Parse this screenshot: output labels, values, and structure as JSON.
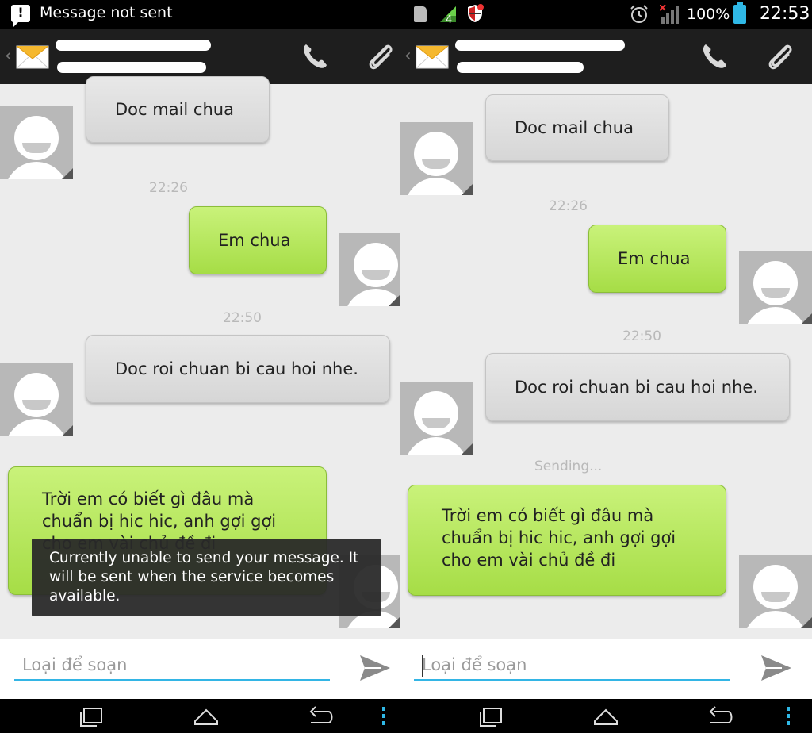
{
  "status_bar": {
    "notification_text": "Message not sent",
    "signal_badge": "4",
    "battery": "100%",
    "clock": "22:53"
  },
  "conversation": {
    "contact_name": "",
    "contact_number": ""
  },
  "messages": [
    {
      "direction": "incoming",
      "text": "Doc mail chua"
    },
    {
      "timestamp": "22:26"
    },
    {
      "direction": "outgoing",
      "text": "Em chua"
    },
    {
      "timestamp": "22:50"
    },
    {
      "direction": "incoming",
      "text": "Doc roi chuan bi cau hoi nhe."
    },
    {
      "direction": "outgoing",
      "text": "Trời em có biết gì đâu mà\nchuẩn bị hic hic,  anh gợi gợi\ncho em vài chủ đề đi"
    }
  ],
  "sending_status": "Sending...",
  "toast_message": "Currently unable to send your message. It will be sent when the service becomes available.",
  "compose": {
    "placeholder": "Loại để soạn"
  },
  "colors": {
    "outgoing_bubble": "#a6dd46",
    "incoming_bubble": "#d6d6d6",
    "accent": "#33b5e5",
    "battery": "#2fb8e6"
  },
  "icons": [
    "alert-icon",
    "sd-card-icon",
    "signal-4-icon",
    "shield-icon",
    "alarm-icon",
    "cell-signal-icon",
    "battery-icon",
    "envelope-icon",
    "call-icon",
    "paperclip-icon",
    "send-icon",
    "recent-apps-icon",
    "home-icon",
    "back-icon",
    "menu-icon"
  ]
}
